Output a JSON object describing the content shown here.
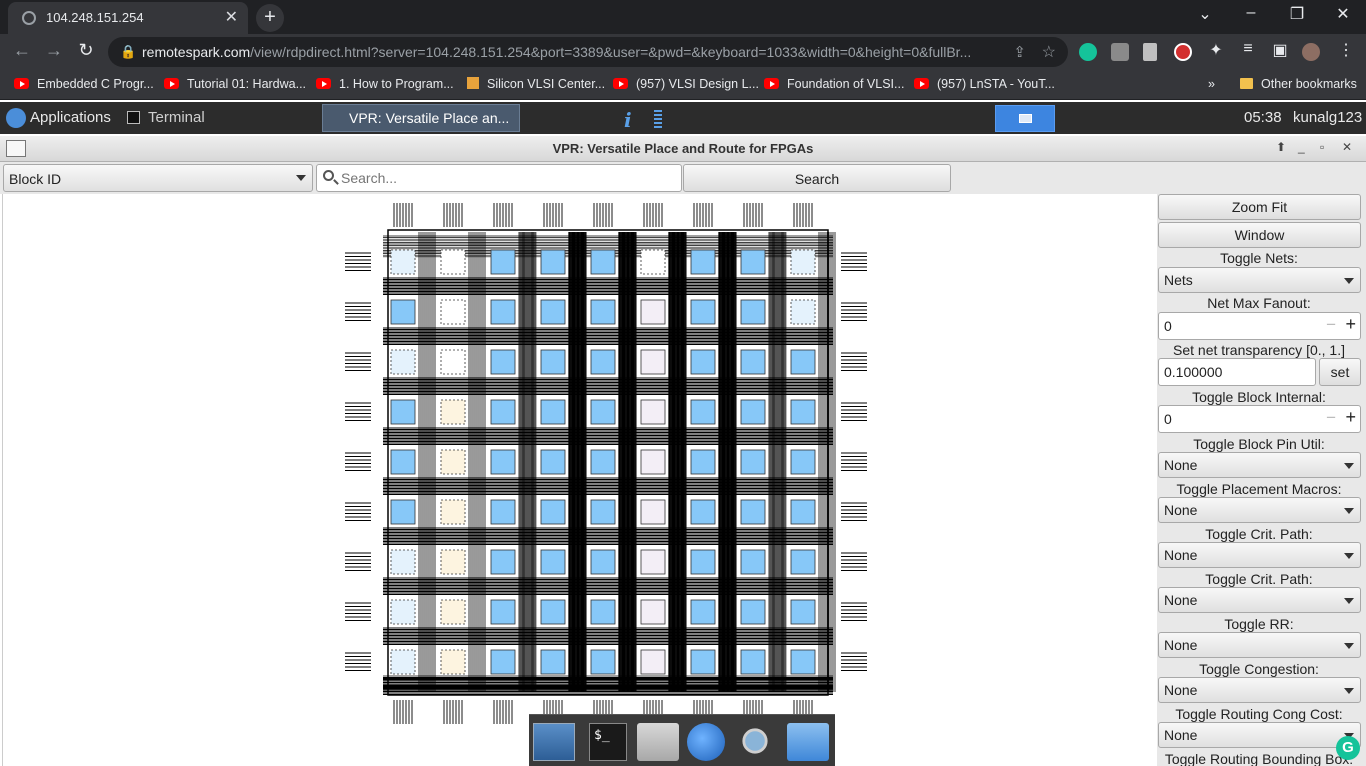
{
  "browser": {
    "tab_title": "104.248.151.254",
    "url_host": "remotespark.com",
    "url_rest": "/view/rdpdirect.html?server=104.248.151.254&port=3389&user=&pwd=&keyboard=1033&width=0&height=0&fullBr...",
    "bookmarks": [
      "Embedded C Progr...",
      "Tutorial 01: Hardwa...",
      "1. How to Program...",
      "Silicon VLSI Center...",
      "(957) VLSI Design L...",
      "Foundation of VLSI...",
      "(957) LnSTA - YouT..."
    ],
    "bookmarks_more": "»",
    "other_bookmarks": "Other bookmarks"
  },
  "panel": {
    "applications": "Applications",
    "terminal": "Terminal",
    "active_task": "VPR: Versatile Place an...",
    "clock": "05:38",
    "user": "kunalg123"
  },
  "vpr": {
    "window_title": "VPR: Versatile Place and Route for FPGAs",
    "block_id": "Block ID",
    "search_placeholder": "Search...",
    "search_button": "Search",
    "zoom_fit": "Zoom Fit",
    "window": "Window",
    "toggle_nets_label": "Toggle Nets:",
    "toggle_nets_value": "Nets",
    "net_max_fanout_label": "Net Max Fanout:",
    "net_max_fanout_value": "0",
    "net_transparency_label": "Set net transparency [0., 1.]",
    "net_transparency_value": "0.100000",
    "set_button": "set",
    "toggle_block_internal_label": "Toggle Block Internal:",
    "toggle_block_internal_value": "0",
    "toggle_block_pin_util_label": "Toggle Block Pin Util:",
    "toggle_block_pin_util_value": "None",
    "toggle_placement_macros_label": "Toggle Placement Macros:",
    "toggle_placement_macros_value": "None",
    "toggle_crit_path_label": "Toggle Crit. Path:",
    "toggle_crit_path_value": "None",
    "toggle_crit_path2_label": "Toggle Crit. Path:",
    "toggle_crit_path2_value": "None",
    "toggle_rr_label": "Toggle RR:",
    "toggle_rr_value": "None",
    "toggle_congestion_label": "Toggle Congestion:",
    "toggle_congestion_value": "None",
    "toggle_routing_cong_cost_label": "Toggle Routing Cong Cost:",
    "toggle_routing_cong_cost_value": "None",
    "toggle_routing_bbox_label": "Toggle Routing Bounding Box:"
  },
  "colors": {
    "clb_used": "#87c8f8",
    "clb_empty": "#e4f2fc",
    "memory": "#fdf4e0",
    "mult": "#f3eef6",
    "routing": "#000000"
  },
  "icons": {
    "dock": [
      "desktop-icon",
      "terminal-icon",
      "home-folder-icon",
      "browser-icon",
      "search-icon",
      "folder-icon"
    ]
  }
}
